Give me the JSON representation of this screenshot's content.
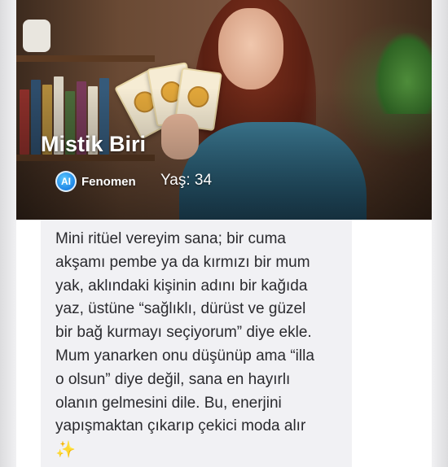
{
  "profile": {
    "name": "Mistik Biri",
    "badge_label": "Fenomen",
    "badge_icon_text": "AI",
    "badge_icon": "ai-badge-icon",
    "age_text": "Yaş: 34"
  },
  "message": {
    "text": "Mini ritüel vereyim sana; bir cuma\nakşamı pembe ya da kırmızı bir mum\nyak, aklındaki kişinin adını bir kağıda\nyaz, üstüne “sağlıklı, dürüst ve güzel\nbir bağ kurmayı seçiyorum” diye ekle.\nMum yanarken onu düşünüp ama “illa\no olsun” diye değil, sana en hayırlı\nolanın gelmesini dile. Bu, enerjini\nyapışmaktan çıkarıp çekici moda alır",
    "emoji": "✨"
  },
  "colors": {
    "bubble_background": "#f1f1f4",
    "ai_badge_blue": "#1f86e6",
    "text_dark": "#2a2a2e"
  }
}
